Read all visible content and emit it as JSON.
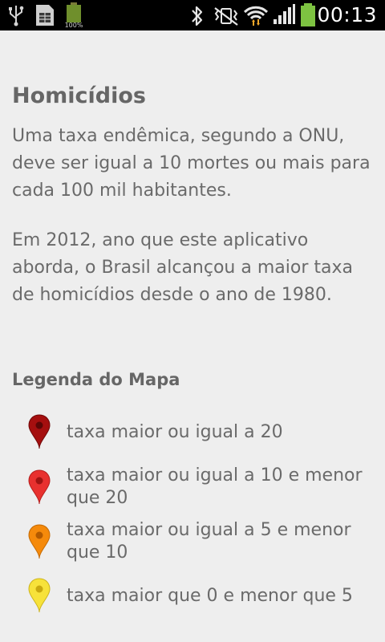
{
  "status_bar": {
    "time": "00:13",
    "battery_level_percent": 100,
    "battery_badge": "100%",
    "icons": [
      "usb-icon",
      "sim-card-icon",
      "battery-small-icon",
      "bluetooth-icon",
      "vibrate-mute-icon",
      "wifi-icon",
      "signal-icon",
      "battery-icon"
    ],
    "colors": {
      "background": "#000000",
      "battery": "#7dc241",
      "wifi_arrows": "#f2a82a"
    }
  },
  "page": {
    "title": "Homicídios",
    "paragraph_1": "Uma taxa endêmica, segundo a ONU, deve ser igual a 10 mortes ou mais para cada 100 mil habitantes.",
    "paragraph_2": "Em 2012, ano que este aplicativo aborda, o Brasil alcançou a maior taxa de homicídios desde o ano de 1980."
  },
  "legend": {
    "title": "Legenda do Mapa",
    "items": [
      {
        "label": "taxa maior ou igual a 20",
        "color": "#a50f0f",
        "icon": "dark-red-map-pin-icon"
      },
      {
        "label": "taxa maior ou igual a 10 e menor que 20",
        "color": "#e8312f",
        "icon": "red-map-pin-icon"
      },
      {
        "label": "taxa maior ou igual a 5 e menor que 10",
        "color": "#f58a0b",
        "icon": "orange-map-pin-icon"
      },
      {
        "label": "taxa maior que 0 e menor que 5",
        "color": "#f7e23a",
        "icon": "yellow-map-pin-icon"
      }
    ]
  },
  "colors": {
    "background": "#eeeeee",
    "text": "#666666"
  }
}
